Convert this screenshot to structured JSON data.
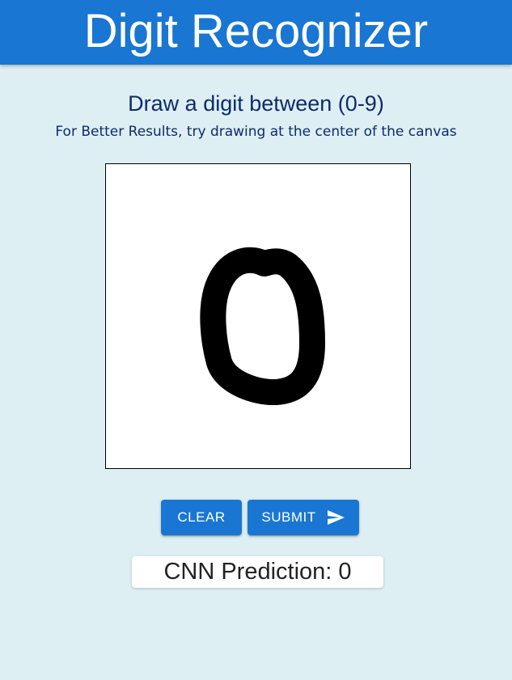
{
  "header": {
    "title": "Digit Recognizer",
    "color": "#1976d2"
  },
  "main": {
    "heading": "Draw a digit between (0-9)",
    "subheading": "For Better Results, try drawing at the center of the canvas"
  },
  "canvas": {
    "drawn_digit": "0",
    "background": "#ffffff",
    "stroke_color": "#000000"
  },
  "buttons": {
    "clear_label": "CLEAR",
    "submit_label": "SUBMIT",
    "submit_icon": "send-icon"
  },
  "prediction": {
    "text": "CNN Prediction: 0"
  }
}
